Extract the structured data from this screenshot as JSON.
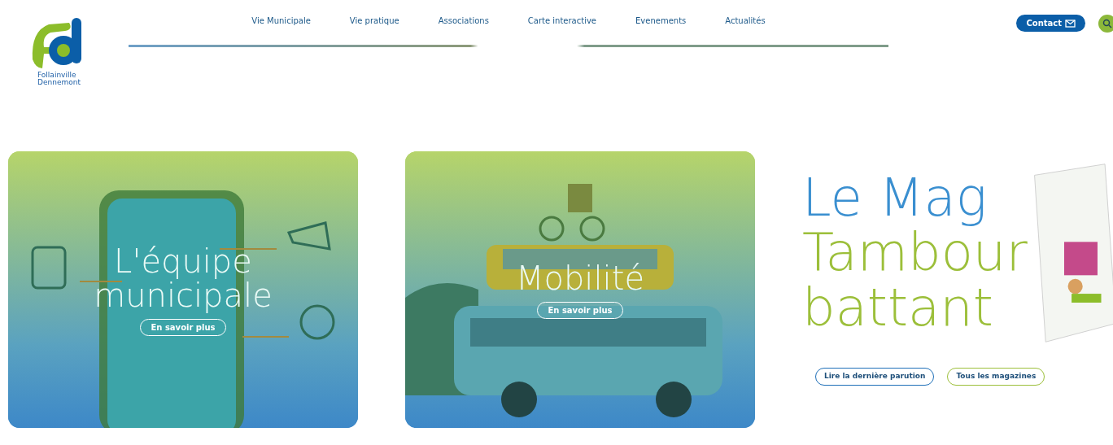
{
  "header": {
    "logo_text": [
      "Follainville",
      "Dennemont"
    ],
    "nav": [
      {
        "label": "Vie Municipale"
      },
      {
        "label": "Vie pratique"
      },
      {
        "label": "Associations"
      },
      {
        "label": "Carte interactive"
      },
      {
        "label": "Evenements"
      },
      {
        "label": "Actualités"
      }
    ],
    "contact_button": "Contact"
  },
  "cards": [
    {
      "kind": "app",
      "title": [
        "L'équipe",
        "municipale"
      ],
      "button": "En savoir plus"
    },
    {
      "kind": "bus",
      "title": [
        "Mobilité"
      ],
      "button": "En savoir plus"
    }
  ],
  "magazine": {
    "title": [
      {
        "text": "Le Mag",
        "color": "#3a8fd0"
      },
      {
        "text": "Tambour",
        "color": "#9cbf3a"
      },
      {
        "text": "battant",
        "color": "#9cbf3a"
      }
    ],
    "buttons": [
      {
        "label": "Lire la dernière parution",
        "color": "#1e6fb8"
      },
      {
        "label": "Tous les magazines",
        "color": "#9cbf3a"
      }
    ]
  }
}
